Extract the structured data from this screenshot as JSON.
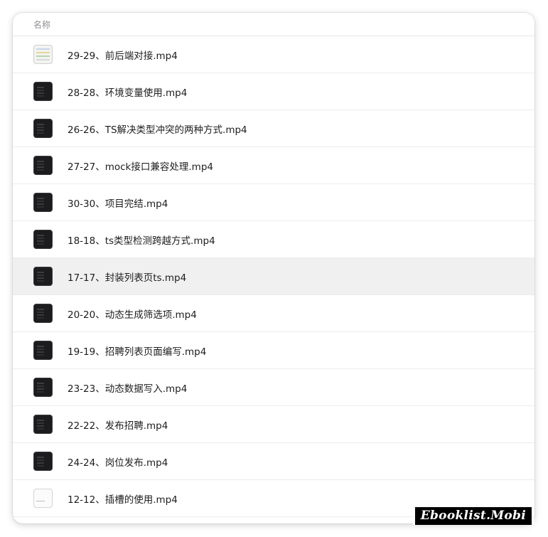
{
  "header": {
    "name_column": "名称"
  },
  "files": [
    {
      "name": "29-29、前后端对接.mp4",
      "thumb": "light"
    },
    {
      "name": "28-28、环境变量使用.mp4",
      "thumb": "dark"
    },
    {
      "name": "26-26、TS解决类型冲突的两种方式.mp4",
      "thumb": "dark"
    },
    {
      "name": "27-27、mock接口兼容处理.mp4",
      "thumb": "dark"
    },
    {
      "name": "30-30、项目完结.mp4",
      "thumb": "dark"
    },
    {
      "name": "18-18、ts类型检测跨越方式.mp4",
      "thumb": "dark"
    },
    {
      "name": "17-17、封装列表页ts.mp4",
      "thumb": "dark",
      "selected": true
    },
    {
      "name": "20-20、动态生成筛选项.mp4",
      "thumb": "dark"
    },
    {
      "name": "19-19、招聘列表页面编写.mp4",
      "thumb": "dark"
    },
    {
      "name": "23-23、动态数据写入.mp4",
      "thumb": "dark"
    },
    {
      "name": "22-22、发布招聘.mp4",
      "thumb": "dark"
    },
    {
      "name": "24-24、岗位发布.mp4",
      "thumb": "dark"
    },
    {
      "name": "12-12、插槽的使用.mp4",
      "thumb": "blank"
    }
  ],
  "watermark": "Ebooklist.Mobi"
}
